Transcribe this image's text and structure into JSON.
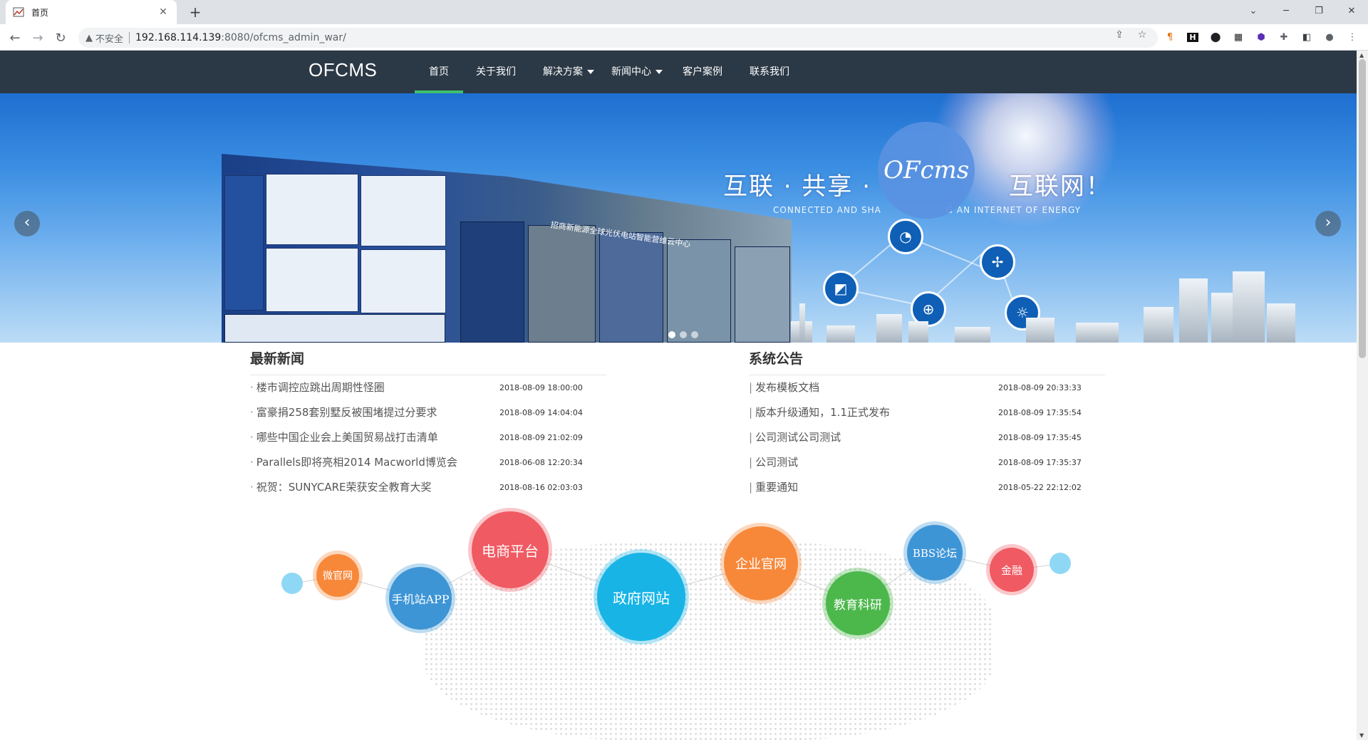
{
  "browser": {
    "tab_title": "首页",
    "tab_close": "✕",
    "new_tab": "+",
    "security_label": "不安全",
    "url_host": "192.168.114.139",
    "url_path": ":8080/ofcms_admin_war/",
    "window_controls": {
      "minimize": "─",
      "restore": "❐",
      "close": "✕"
    }
  },
  "site": {
    "logo": "OFCMS",
    "nav": [
      {
        "label": "首页",
        "active": true
      },
      {
        "label": "关于我们"
      },
      {
        "label": "解决方案",
        "dropdown": true
      },
      {
        "label": "新闻中心",
        "dropdown": true
      },
      {
        "label": "客户案例"
      },
      {
        "label": "联系我们"
      }
    ]
  },
  "banner": {
    "slogan": "互联 · 共享 · 　　　　　互联网！",
    "slogan_en": "CONNECTED AND SHA　　　　　　　G AN INTERNET OF ENERGY",
    "logo_text": "OFcms",
    "screen_title": "招商新能源全球光伏电站智能营维云中心",
    "prev": "‹",
    "next": "›",
    "slides": 3,
    "active_slide": 0
  },
  "news": {
    "heading": "最新新闻",
    "items": [
      {
        "title": "楼市调控应跳出周期性怪圈",
        "date": "2018-08-09 18:00:00"
      },
      {
        "title": "富豪捐258套别墅反被围堵提过分要求",
        "date": "2018-08-09 14:04:04"
      },
      {
        "title": "哪些中国企业会上美国贸易战打击清单",
        "date": "2018-08-09 21:02:09"
      },
      {
        "title": "Parallels即将亮相2014 Macworld博览会",
        "date": "2018-06-08 12:20:34"
      },
      {
        "title": "祝贺：SUNYCARE荣获安全教育大奖",
        "date": "2018-08-16 02:03:03"
      }
    ]
  },
  "notices": {
    "heading": "系统公告",
    "items": [
      {
        "title": "发布模板文档",
        "date": "2018-08-09 20:33:33"
      },
      {
        "title": "版本升级通知，1.1正式发布",
        "date": "2018-08-09 17:35:54"
      },
      {
        "title": "公司测试公司测试",
        "date": "2018-08-09 17:35:45"
      },
      {
        "title": "公司测试",
        "date": "2018-08-09 17:35:37"
      },
      {
        "title": "重要通知",
        "date": "2018-05-22 22:12:02"
      }
    ]
  },
  "solutions": [
    {
      "label": "",
      "color": "#8fd8f5"
    },
    {
      "label": "微官网",
      "color": "#f7883a"
    },
    {
      "label": "手机站APP",
      "color": "#3d95d6"
    },
    {
      "label": "电商平台",
      "color": "#f05a63"
    },
    {
      "label": "政府网站",
      "color": "#18b4e6"
    },
    {
      "label": "企业官网",
      "color": "#f7883a"
    },
    {
      "label": "教育科研",
      "color": "#4cb84c"
    },
    {
      "label": "BBS论坛",
      "color": "#3d95d6"
    },
    {
      "label": "金融",
      "color": "#f05a63"
    },
    {
      "label": "",
      "color": "#8fd8f5"
    }
  ]
}
